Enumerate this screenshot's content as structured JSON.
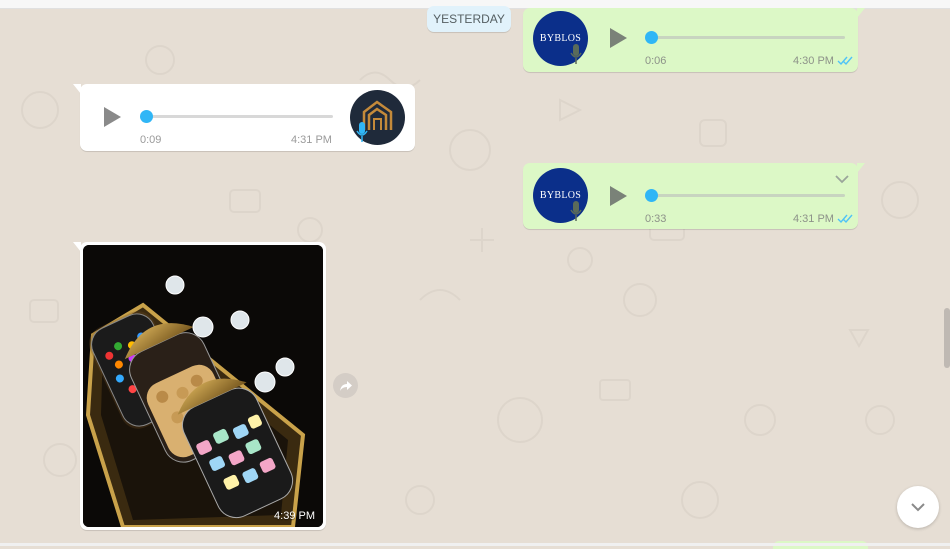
{
  "date_separator": "YESTERDAY",
  "messages": [
    {
      "type": "voice",
      "direction": "outgoing",
      "avatar": "BYBLOS",
      "duration": "0:06",
      "time": "4:30 PM",
      "status": "read"
    },
    {
      "type": "voice",
      "direction": "incoming",
      "avatar": "house-logo",
      "duration": "0:09",
      "time": "4:31 PM"
    },
    {
      "type": "voice",
      "direction": "outgoing",
      "avatar": "BYBLOS",
      "duration": "0:33",
      "time": "4:31 PM",
      "status": "read"
    },
    {
      "type": "image",
      "direction": "incoming",
      "time": "4:39 PM",
      "description_icon": "candy-jars-photo"
    }
  ],
  "colors": {
    "outgoing_bubble": "#dcf8c6",
    "incoming_bubble": "#ffffff",
    "accent_blue": "#30b6f6",
    "read_ticks": "#4fc3f7",
    "chat_background": "#e6ded4"
  },
  "icons": {
    "play": "play-icon",
    "mic": "mic-icon",
    "forward": "forward-icon",
    "scroll_down": "chevron-down-icon",
    "message_menu": "chevron-down-icon"
  }
}
